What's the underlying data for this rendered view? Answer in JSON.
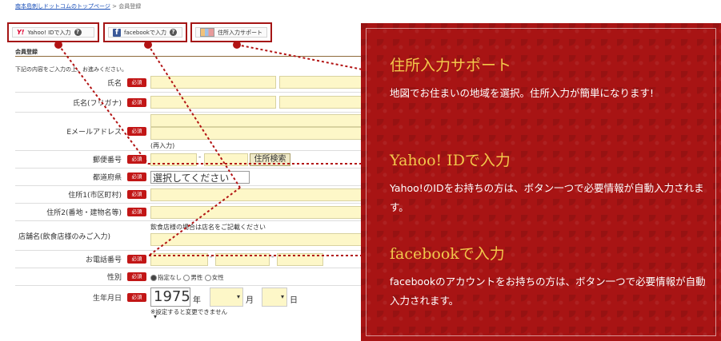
{
  "breadcrumb": {
    "link": "南本島刺しドットコムのトップページ",
    "sep": " > ",
    "current": "会員登録"
  },
  "buttons": {
    "yahoo": {
      "icon_text": "Y!",
      "label": "Yahoo! IDで入力",
      "help": "?"
    },
    "facebook": {
      "icon_text": "f",
      "label": "facebookで入力",
      "help": "?"
    },
    "address": {
      "label": "住所入力サポート"
    }
  },
  "section": {
    "title": "会員登録",
    "intro": "下記の内容をご入力の上、お進みください。"
  },
  "required_badge": "必須",
  "form": {
    "name_label": "氏名",
    "kana_label": "氏名(フリガナ)",
    "email_label": "Eメールアドレス",
    "email_reenter": "(再入力)",
    "zip_label": "郵便番号",
    "zip_sep": "-",
    "zip_button": "住所検索",
    "pref_label": "都道府県",
    "pref_select": "選択してください",
    "addr1_label": "住所1(市区町村)",
    "addr2_label": "住所2(番地・建物名等)",
    "shop_label": "店舗名(飲食店様のみご入力)",
    "shop_note": "飲食店様の場合は店名をご記載ください",
    "phone_label": "お電話番号",
    "phone_sep": "-",
    "gender_label": "性別",
    "gender_options": [
      "指定なし",
      "男性",
      "女性"
    ],
    "birth_label": "生年月日",
    "birth_year": "1975",
    "birth_year_unit": "年",
    "birth_month_unit": "月",
    "birth_day_unit": "日",
    "birth_note": "※設定すると変更できません"
  },
  "promo": {
    "address": {
      "title": "住所入力サポート",
      "body": "地図でお住まいの地域を選択。住所入力が簡単になります!"
    },
    "yahoo": {
      "title": "Yahoo! IDで入力",
      "body": "Yahoo!のIDをお持ちの方は、ボタン一つで必要情報が自動入力されます。"
    },
    "facebook": {
      "title": "facebookで入力",
      "body": "facebookのアカウントをお持ちの方は、ボタン一つで必要情報が自動入力されます。"
    }
  },
  "colors": {
    "accent_red": "#a81414",
    "gold_title": "#f2c84b",
    "field_yellow": "#fdf7c8",
    "link_blue": "#1a4fb8"
  }
}
